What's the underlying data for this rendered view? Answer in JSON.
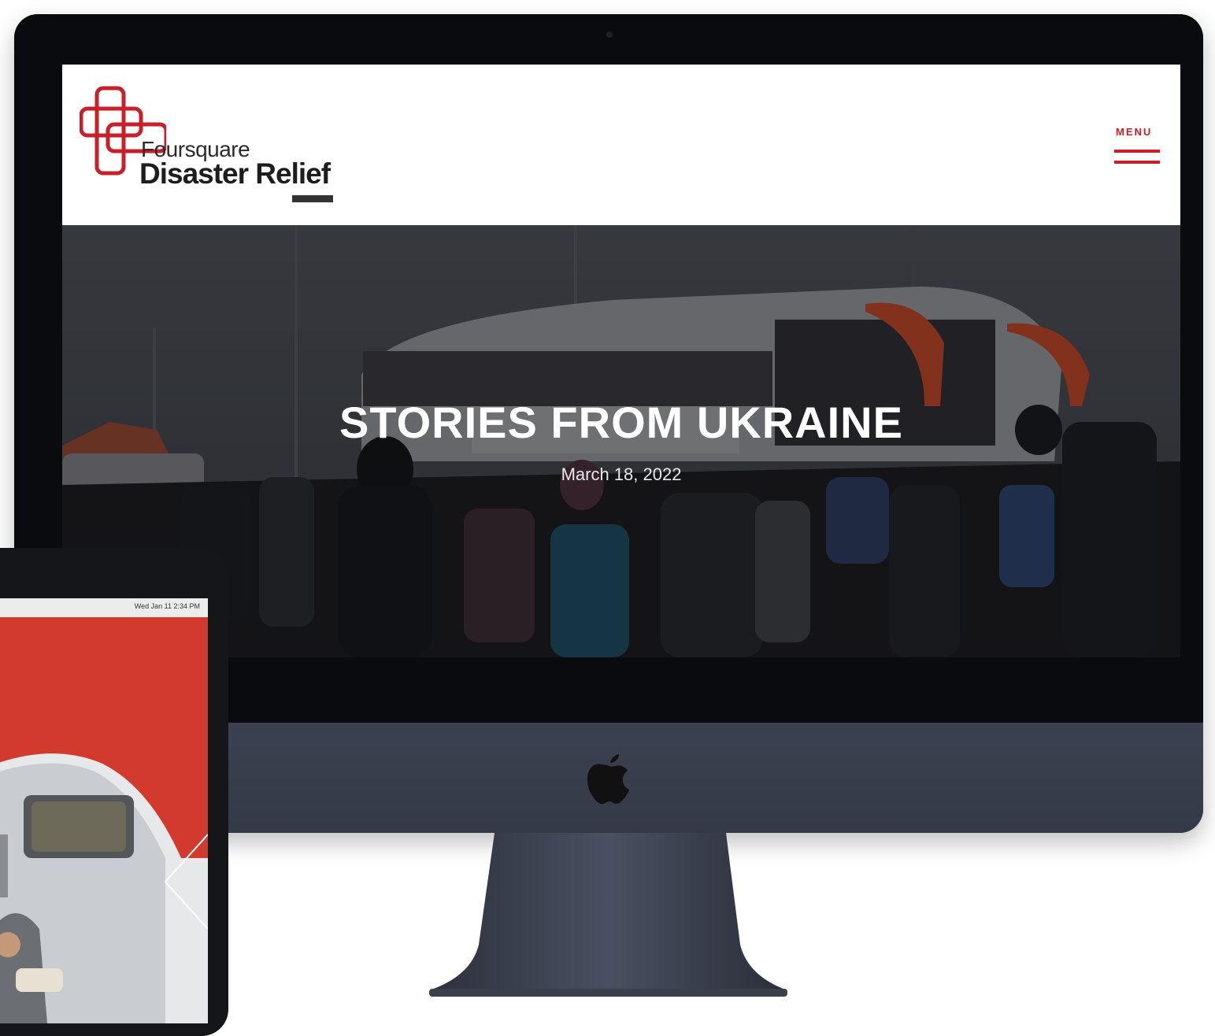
{
  "site": {
    "logo_line1": "Foursquare",
    "logo_line2": "Disaster Relief",
    "menu_label": "MENU",
    "brand_color": "#c8202a"
  },
  "hero": {
    "title": "STORIES FROM UKRAINE",
    "date": "March 18, 2022"
  },
  "tablet": {
    "menubar_clock": "Wed Jan 11 2:34 PM"
  }
}
